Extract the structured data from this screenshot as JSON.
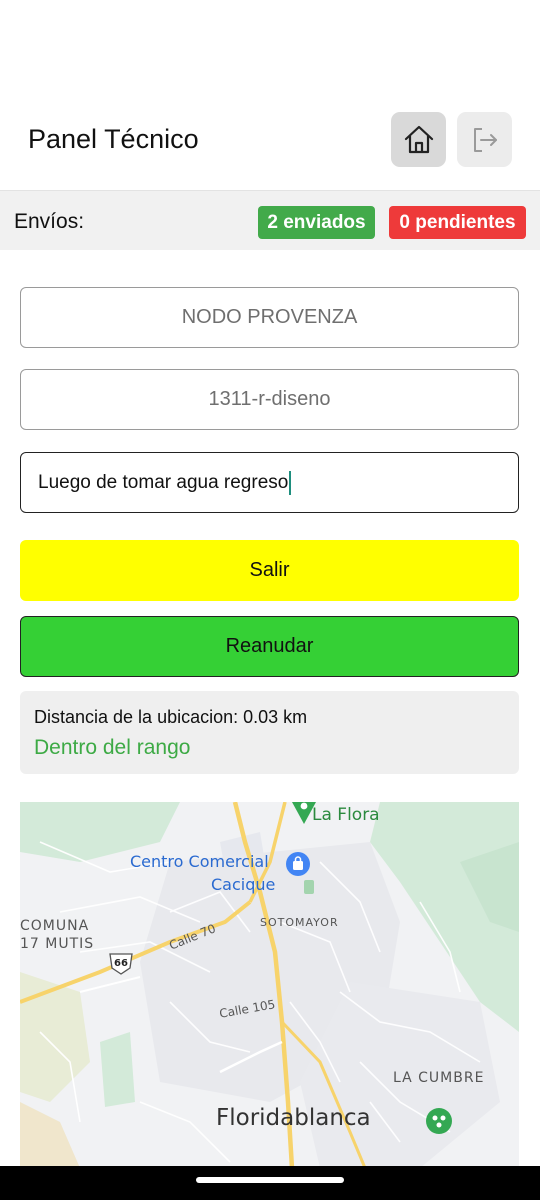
{
  "header": {
    "title": "Panel Técnico",
    "home_icon": "home-icon",
    "logout_icon": "logout-icon"
  },
  "envios": {
    "label": "Envíos:",
    "sent": "2 enviados",
    "pending": "0 pendientes",
    "sent_color": "#42aa4a",
    "pending_color": "#ee3a3a"
  },
  "form": {
    "node": "NODO PROVENZA",
    "code": "1311-r-diseno",
    "note": "Luego de tomar agua regreso"
  },
  "actions": {
    "exit_label": "Salir",
    "resume_label": "Reanudar",
    "exit_color": "#ffff00",
    "resume_color": "#35d035"
  },
  "distance": {
    "text": "Distancia de la ubicacion: 0.03 km",
    "status": "Dentro del rango",
    "status_color": "#3daa45"
  },
  "map": {
    "labels": {
      "la_flora": "La Flora",
      "centro_comercial": "Centro Comercial",
      "cacique": "Cacique",
      "comuna": "COMUNA",
      "mutis": "17 MUTIS",
      "sotomayor": "SOTOMAYOR",
      "calle_70": "Calle 70",
      "route_66": "66",
      "calle_105": "Calle 105",
      "la_cumbre": "LA CUMBRE",
      "floridablanca": "Floridablanca"
    }
  }
}
